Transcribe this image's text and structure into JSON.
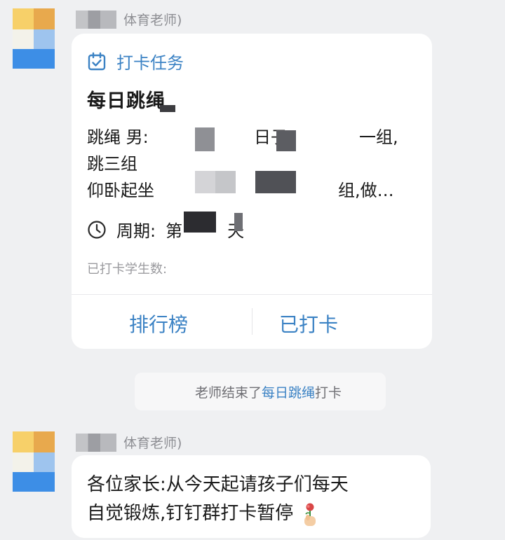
{
  "messages": [
    {
      "sender_role": "体育老师)"
    },
    {
      "sender_role": "体育老师)"
    }
  ],
  "task_card": {
    "tag": "打卡任务",
    "title": "每日跳绳",
    "line1_start": "跳绳 男:",
    "line1_mid": "日子",
    "line1_end": "一组,",
    "line2": "跳三组",
    "line3_start": "仰卧起坐",
    "line3_end": "组,做…",
    "cycle_label": "周期:",
    "cycle_first": "第",
    "cycle_end": "天",
    "count_label": "已打卡学生数:",
    "btn_rank": "排行榜",
    "btn_done": "已打卡"
  },
  "notice": {
    "prefix": "老师结束了",
    "highlight": "每日跳绳",
    "suffix": "打卡"
  },
  "bubble": {
    "line1": "各位家长:从今天起请孩子们每天",
    "line2": "自觉锻炼,钉钉群打卡暂停",
    "emoji": "🌹"
  },
  "colors": {
    "accent": "#3b82c4",
    "background": "#eff0f2",
    "card": "#ffffff"
  },
  "icons": {
    "tag": "calendar-check-icon",
    "cycle": "clock-icon",
    "emoji": "rose-hand-icon"
  }
}
